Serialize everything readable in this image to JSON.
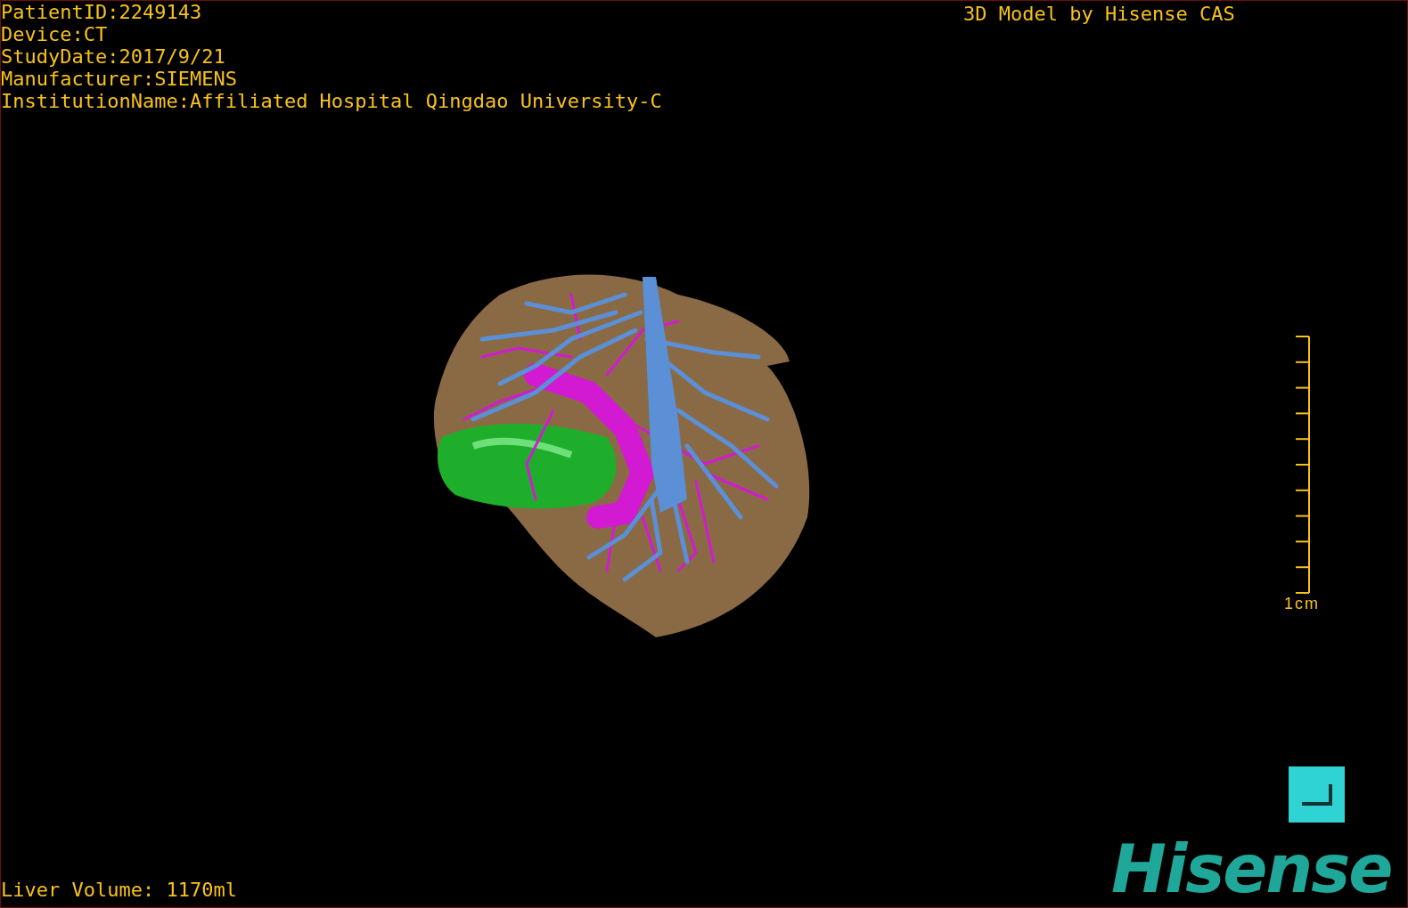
{
  "patient_info": [
    "PatientID:2249143",
    "Device:CT",
    "StudyDate:2017/9/21",
    "Manufacturer:SIEMENS",
    "InstitutionName:Affiliated Hospital Qingdao University-C"
  ],
  "caption": "3D Model by Hisense CAS",
  "scale_bar": {
    "label": "1cm"
  },
  "liver_volume": "Liver Volume: 1170ml",
  "logo": "Hisense"
}
